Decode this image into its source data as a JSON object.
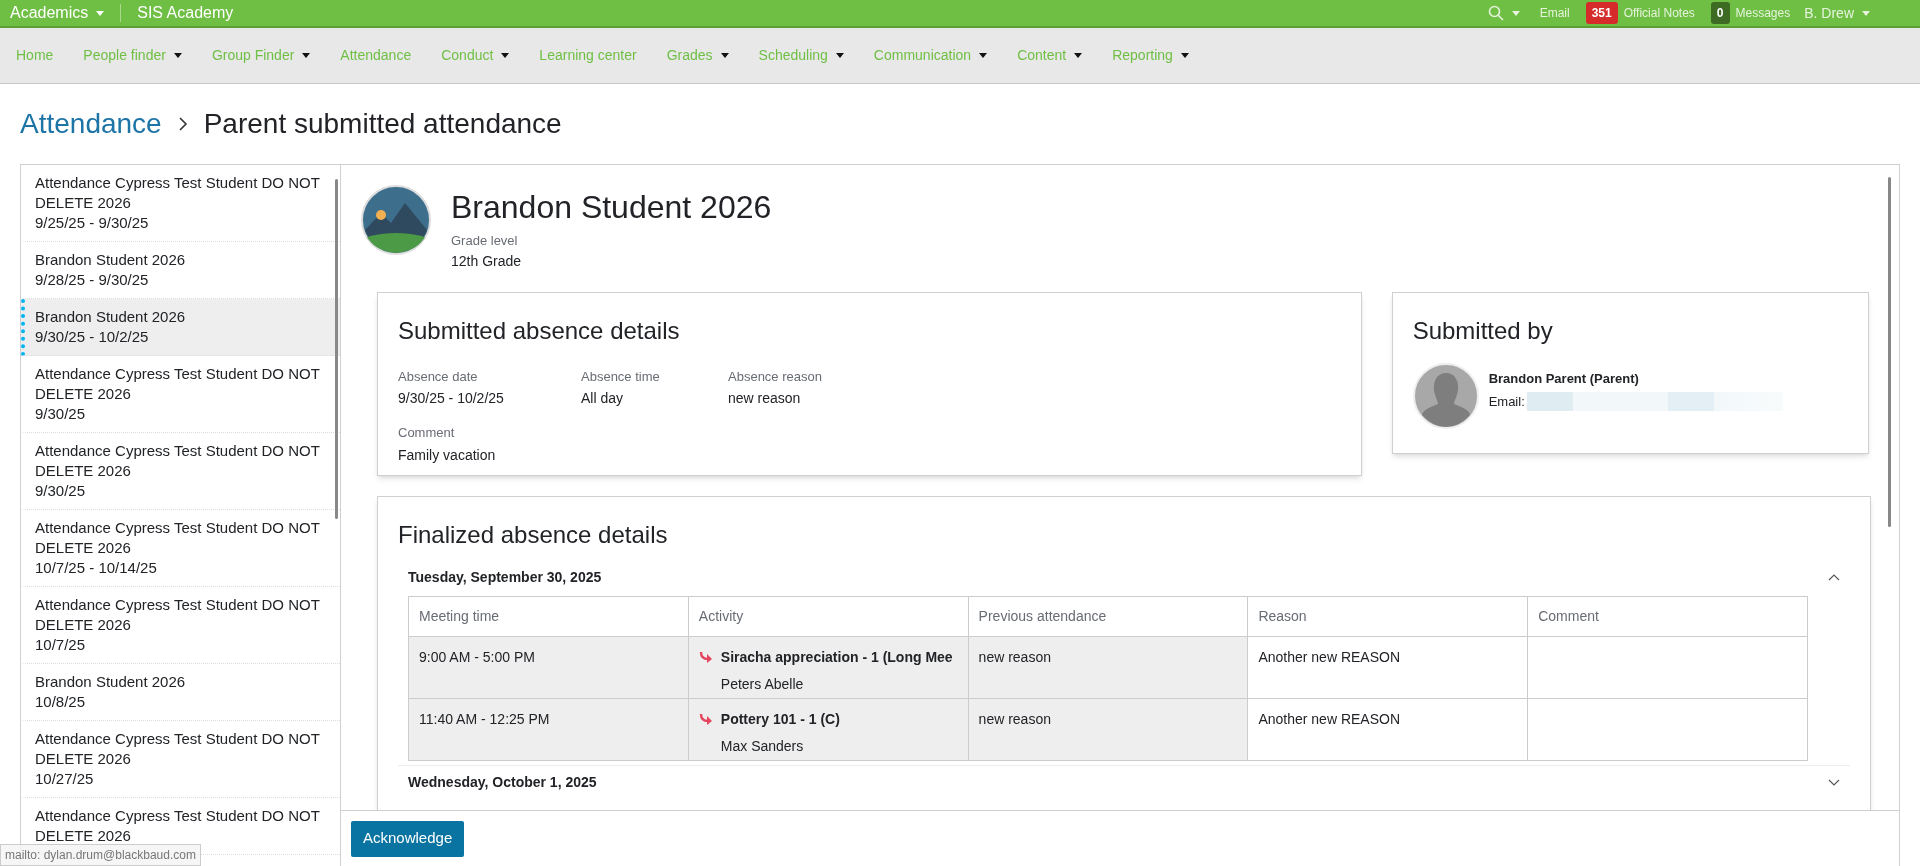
{
  "top_bar": {
    "app_menu": "Academics",
    "school": "SIS Academy",
    "email": "Email",
    "notes_count": "351",
    "notes_label": "Official Notes",
    "messages_count": "0",
    "messages_label": "Messages",
    "user": "B. Drew"
  },
  "nav": [
    {
      "label": "Home",
      "has_menu": false
    },
    {
      "label": "People finder",
      "has_menu": true
    },
    {
      "label": "Group Finder",
      "has_menu": true
    },
    {
      "label": "Attendance",
      "has_menu": false
    },
    {
      "label": "Conduct",
      "has_menu": true
    },
    {
      "label": "Learning center",
      "has_menu": false
    },
    {
      "label": "Grades",
      "has_menu": true
    },
    {
      "label": "Scheduling",
      "has_menu": true
    },
    {
      "label": "Communication",
      "has_menu": true
    },
    {
      "label": "Content",
      "has_menu": true
    },
    {
      "label": "Reporting",
      "has_menu": true
    }
  ],
  "breadcrumb": {
    "parent": "Attendance",
    "current": "Parent submitted attendance"
  },
  "sidebar": {
    "items": [
      {
        "name": "Attendance Cypress Test Student DO NOT DELETE 2026",
        "dates": "9/25/25 - 9/30/25",
        "selected": false
      },
      {
        "name": "Brandon Student 2026",
        "dates": "9/28/25 - 9/30/25",
        "selected": false
      },
      {
        "name": "Brandon Student 2026",
        "dates": "9/30/25 - 10/2/25",
        "selected": true
      },
      {
        "name": "Attendance Cypress Test Student DO NOT DELETE 2026",
        "dates": "9/30/25",
        "selected": false
      },
      {
        "name": "Attendance Cypress Test Student DO NOT DELETE 2026",
        "dates": "9/30/25",
        "selected": false
      },
      {
        "name": "Attendance Cypress Test Student DO NOT DELETE 2026",
        "dates": "10/7/25 - 10/14/25",
        "selected": false
      },
      {
        "name": "Attendance Cypress Test Student DO NOT DELETE 2026",
        "dates": "10/7/25",
        "selected": false
      },
      {
        "name": "Brandon Student 2026",
        "dates": "10/8/25",
        "selected": false
      },
      {
        "name": "Attendance Cypress Test Student DO NOT DELETE 2026",
        "dates": "10/27/25",
        "selected": false
      },
      {
        "name": "Attendance Cypress Test Student DO NOT DELETE 2026",
        "selected": false
      }
    ]
  },
  "student": {
    "name": "Brandon Student 2026",
    "grade_label": "Grade level",
    "grade": "12th Grade"
  },
  "submitted": {
    "title": "Submitted absence details",
    "fields": [
      {
        "label": "Absence date",
        "value": "9/30/25 - 10/2/25"
      },
      {
        "label": "Absence time",
        "value": "All day"
      },
      {
        "label": "Absence reason",
        "value": "new reason"
      }
    ],
    "comment_label": "Comment",
    "comment": "Family vacation"
  },
  "submitted_by": {
    "title": "Submitted by",
    "name": "Brandon Parent (Parent)",
    "email_label": "Email:"
  },
  "finalized": {
    "title": "Finalized absence details",
    "days": [
      {
        "date": "Tuesday, September 30, 2025",
        "expanded": true,
        "columns": [
          "Meeting time",
          "Activity",
          "Previous attendance",
          "Reason",
          "Comment"
        ],
        "rows": [
          {
            "time": "9:00 AM - 5:00 PM",
            "activity": "Siracha appreciation - 1 (Long Mee",
            "teacher": "Peters Abelle",
            "previous": "new reason",
            "reason": "Another new REASON"
          },
          {
            "time": "11:40 AM - 12:25 PM",
            "activity": "Pottery 101 - 1 (C)",
            "teacher": "Max Sanders",
            "previous": "new reason",
            "reason": "Another new REASON"
          }
        ]
      },
      {
        "date": "Wednesday, October 1, 2025",
        "expanded": false
      }
    ]
  },
  "acknowledge": "Acknowledge",
  "status_url": "mailto: dylan.drum@blackbaud.com"
}
